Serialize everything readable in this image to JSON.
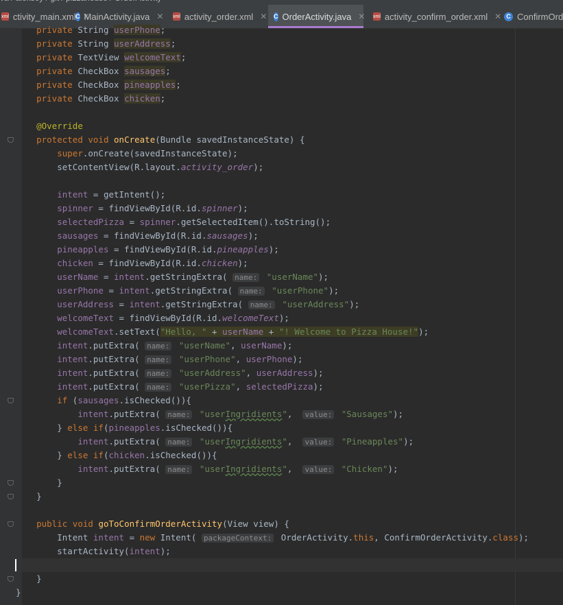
{
  "breadcrumb": [
    "va",
    "aleksey",
    "git",
    "pizzahouse",
    "OrderActivity"
  ],
  "tabs": [
    {
      "label": "ctivity_main.xml",
      "type": "xml",
      "active": false
    },
    {
      "label": "MainActivity.java",
      "type": "java",
      "active": false
    },
    {
      "label": "activity_order.xml",
      "type": "xml",
      "active": false
    },
    {
      "label": "OrderActivity.java",
      "type": "java",
      "active": true
    },
    {
      "label": "activity_confirm_order.xml",
      "type": "xml",
      "active": false
    },
    {
      "label": "ConfirmOrde",
      "type": "java",
      "active": false
    }
  ],
  "tab_close": "✕",
  "icons": {
    "java": "C",
    "xml": "xml"
  },
  "colors": {
    "keyword": "#cc7832",
    "field": "#9876aa",
    "method": "#ffc66d",
    "string": "#6a8759",
    "annotation": "#bbb529",
    "active_tab_underline": "#a97bd1"
  },
  "code": [
    "    private String userPhone;",
    "    private String userAddress;",
    "    private TextView welcomeText;",
    "    private CheckBox sausages;",
    "    private CheckBox pineapples;",
    "    private CheckBox chicken;",
    "",
    "    @Override",
    "    protected void onCreate(Bundle savedInstanceState) {",
    "        super.onCreate(savedInstanceState);",
    "        setContentView(R.layout.activity_order);",
    "",
    "        intent = getIntent();",
    "        spinner = findViewById(R.id.spinner);",
    "        selectedPizza = spinner.getSelectedItem().toString();",
    "        sausages = findViewById(R.id.sausages);",
    "        pineapples = findViewById(R.id.pineapples);",
    "        chicken = findViewById(R.id.chicken);",
    "        userName = intent.getStringExtra( name: \"userName\");",
    "        userPhone = intent.getStringExtra( name: \"userPhone\");",
    "        userAddress = intent.getStringExtra( name: \"userAddress\");",
    "        welcomeText = findViewById(R.id.welcomeText);",
    "        welcomeText.setText(\"Hello, \" + userName + \"! Welcome to Pizza House!\");",
    "        intent.putExtra( name: \"userName\", userName);",
    "        intent.putExtra( name: \"userPhone\", userPhone);",
    "        intent.putExtra( name: \"userAddress\", userAddress);",
    "        intent.putExtra( name: \"userPizza\", selectedPizza);",
    "        if (sausages.isChecked()){",
    "            intent.putExtra( name: \"userIngridients\",  value: \"Sausages\");",
    "        } else if(pineapples.isChecked()){",
    "            intent.putExtra( name: \"userIngridients\",  value: \"Pineapples\");",
    "        } else if(chicken.isChecked()){",
    "            intent.putExtra( name: \"userIngridients\",  value: \"Chicken\");",
    "        }",
    "    }",
    "",
    "    public void goToConfirmOrderActivity(View view) {",
    "        Intent intent = new Intent( packageContext: OrderActivity.this, ConfirmOrderActivity.class);",
    "        startActivity(intent);",
    "",
    "    }",
    "}"
  ]
}
